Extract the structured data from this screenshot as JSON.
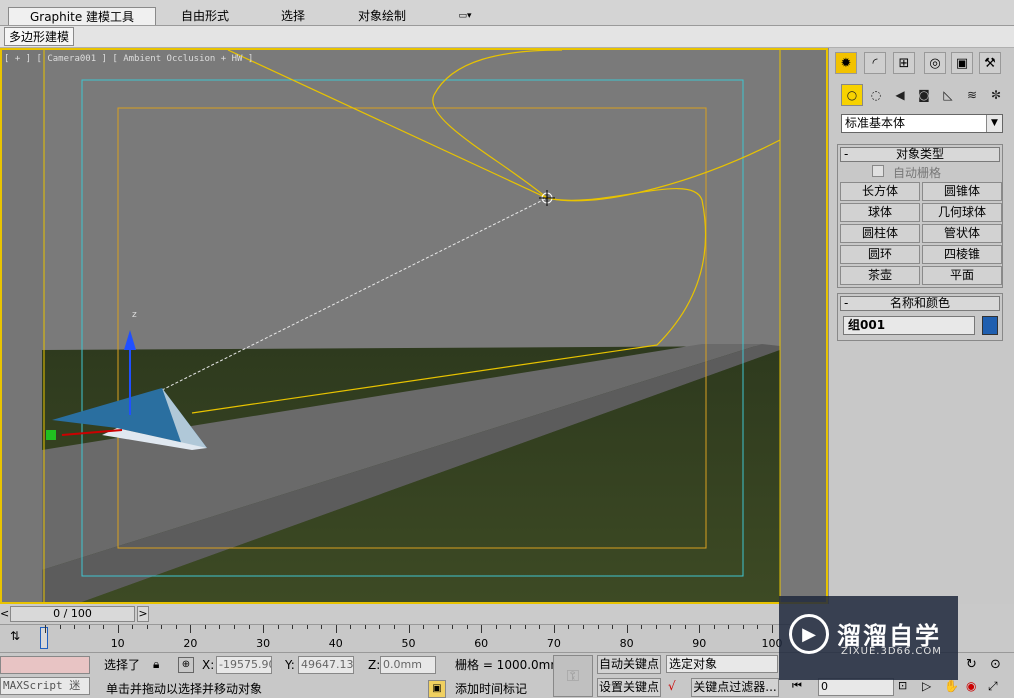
{
  "ribbon": {
    "tabs": [
      {
        "label": "Graphite 建模工具"
      },
      {
        "label": "自由形式"
      },
      {
        "label": "选择"
      },
      {
        "label": "对象绘制"
      }
    ],
    "subtab": "多边形建模"
  },
  "viewport": {
    "label": "[ + ] [ Camera001 ] [ Ambient Occlusion + HW ]",
    "gizmo_axis": "z"
  },
  "panel": {
    "tabs": [
      "sun-icon",
      "curve-icon",
      "hierarchy-icon",
      "motion-icon",
      "display-icon",
      "hammer-icon"
    ],
    "create_icons": [
      "sphere-icon",
      "shapes-icon",
      "light-icon",
      "camera-icon",
      "helper-icon",
      "spacewarp-icon",
      "systems-icon"
    ],
    "category": "标准基本体",
    "object_type": {
      "title": "对象类型",
      "autogrid": "自动栅格",
      "buttons": [
        "长方体",
        "圆锥体",
        "球体",
        "几何球体",
        "圆柱体",
        "管状体",
        "圆环",
        "四棱锥",
        "茶壶",
        "平面"
      ]
    },
    "name_color": {
      "title": "名称和颜色",
      "name": "组001",
      "color": "#1f5fb0"
    }
  },
  "timeline": {
    "frame": "0 / 100",
    "prev": "<",
    "next": ">",
    "ticks": [
      "0",
      "10",
      "20",
      "30",
      "40",
      "50",
      "60",
      "70",
      "80",
      "90",
      "100"
    ]
  },
  "status": {
    "maxscript": "MAXScript 迷",
    "selection": "选择了",
    "prompt": "单击并拖动以选择并移动对象",
    "x_label": "X:",
    "x_value": "-19575.903",
    "y_label": "Y:",
    "y_value": "49647.134",
    "z_label": "Z:",
    "z_value": "0.0mm",
    "grid": "栅格 = 1000.0mm",
    "add_time_tag": "添加时间标记",
    "auto_key": "自动关键点",
    "set_key": "设置关键点",
    "selected_object": "选定对象",
    "key_filter": "关键点过滤器...",
    "frame_value": "0"
  },
  "watermark": {
    "text": "溜溜自学",
    "url": "ZIXUE.3D66.COM"
  }
}
